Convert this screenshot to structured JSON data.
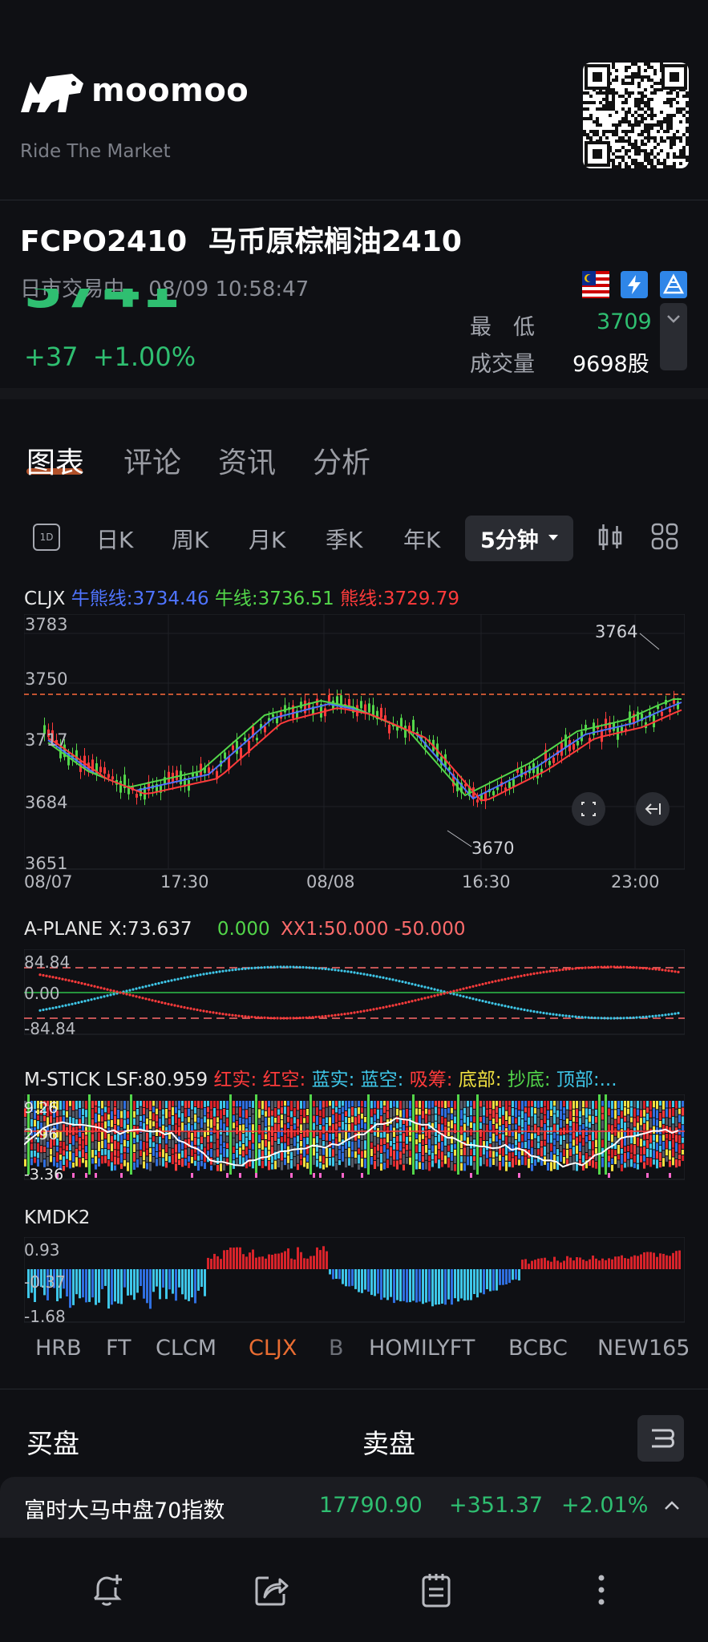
{
  "brand": {
    "name": "moomoo",
    "tagline": "Ride The Market"
  },
  "header": {
    "symbol": "FCPO2410",
    "name": "马币原棕榈油2410",
    "status": "日市交易中",
    "datetime": "08/09 10:58:47",
    "price": "3741",
    "change": "+37",
    "change_pct": "+1.00%",
    "stats": [
      {
        "label": "最　低",
        "value": "3709"
      },
      {
        "label": "成交量",
        "value": "9698股"
      }
    ]
  },
  "tabs": [
    "图表",
    "评论",
    "资讯",
    "分析"
  ],
  "periods": [
    "日K",
    "周K",
    "月K",
    "季K",
    "年K"
  ],
  "period_selected": "5分钟",
  "period_icon_label": "1D",
  "main_chart": {
    "indicator": "CLJX",
    "legend": [
      {
        "text": "牛熊线:3734.46",
        "color": "#4f74ff"
      },
      {
        "text": "牛线:3736.51",
        "color": "#53d64a"
      },
      {
        "text": "熊线:3729.79",
        "color": "#ff3b3b"
      }
    ],
    "y_ticks": [
      "3783",
      "3750",
      "3717",
      "3684",
      "3651"
    ],
    "x_ticks": [
      "08/07",
      "17:30",
      "08/08",
      "16:30",
      "23:00"
    ],
    "annot_high": "3764",
    "annot_low": "3670"
  },
  "aplane": {
    "title": "A-PLANE X:73.637",
    "v0": "0.000",
    "v1": "XX1:50.000 -50.000",
    "ticks": [
      "84.84",
      "0.00",
      "-84.84"
    ]
  },
  "mstick": {
    "title": "M-STICK LSF:80.959",
    "legend": [
      {
        "text": "红实:",
        "color": "#ff3b3b"
      },
      {
        "text": "红空:",
        "color": "#ff3b3b"
      },
      {
        "text": "蓝实:",
        "color": "#3ec6e8"
      },
      {
        "text": "蓝空:",
        "color": "#3ec6e8"
      },
      {
        "text": "吸筹:",
        "color": "#ff3b3b"
      },
      {
        "text": "底部:",
        "color": "#f0e040"
      },
      {
        "text": "抄底:",
        "color": "#53d64a"
      },
      {
        "text": "顶部:...",
        "color": "#3ec6e8"
      }
    ],
    "ticks": [
      "9.26",
      "2.96",
      "-3.36"
    ]
  },
  "kmdk": {
    "title": "KMDK2",
    "ticks": [
      "0.93",
      "-0.37",
      "-1.68"
    ]
  },
  "indicator_tabs": [
    "HRB",
    "FT",
    "CLCM",
    "CLJX",
    "B",
    "HOMILYFT",
    "BCBC",
    "NEW165"
  ],
  "indicator_selected": "CLJX",
  "orderbook": {
    "buy": "买盘",
    "sell": "卖盘"
  },
  "ticker": {
    "name": "富时大马中盘70指数",
    "value": "17790.90",
    "change": "+351.37",
    "pct": "+2.01%"
  },
  "colors": {
    "up": "#2fbf71",
    "down": "#ff3b3b",
    "accent": "#ea6d32"
  }
}
